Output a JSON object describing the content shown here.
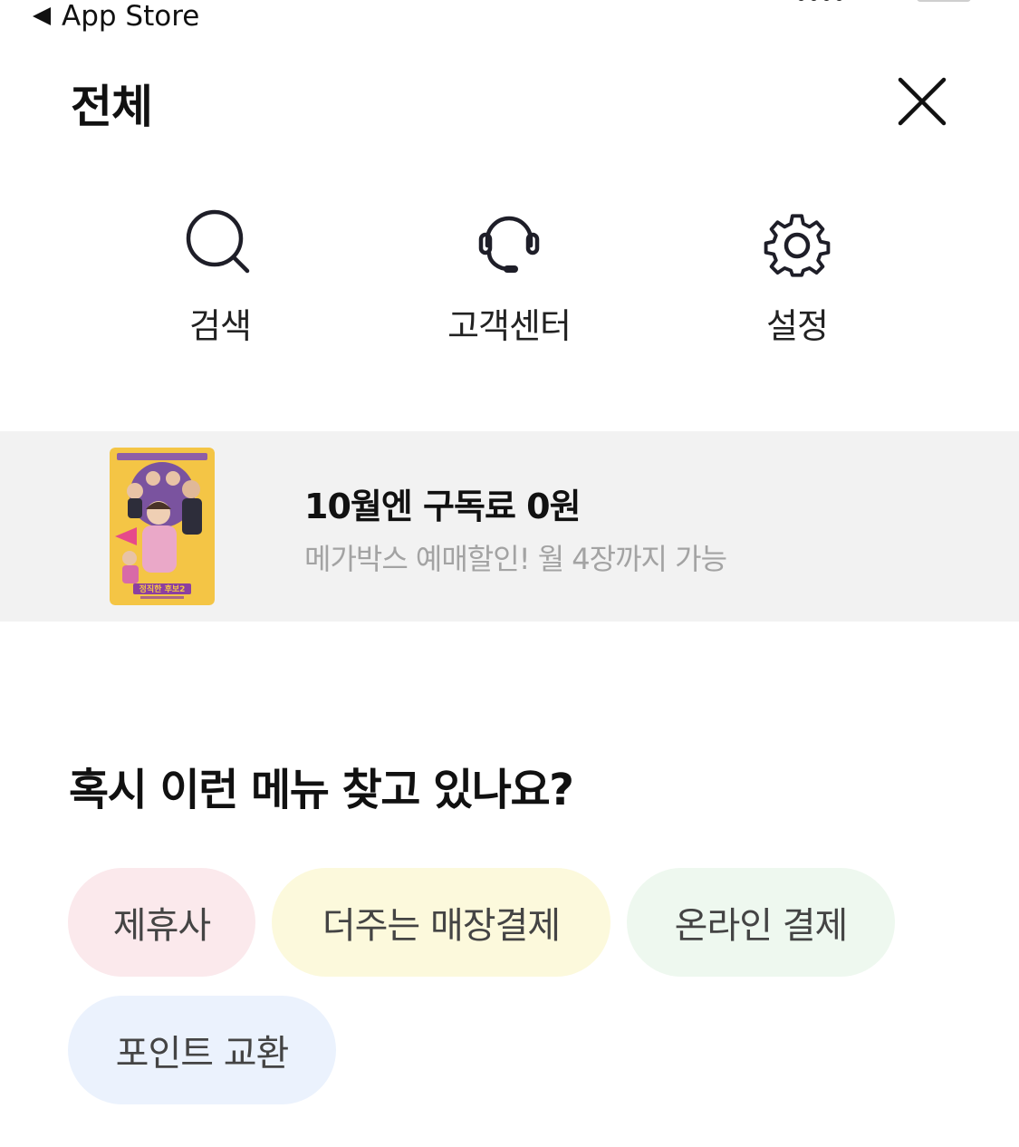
{
  "status_bar": {
    "back_label": "App Store"
  },
  "header": {
    "title": "전체"
  },
  "quick_menu": [
    {
      "label": "검색",
      "icon": "search-icon"
    },
    {
      "label": "고객센터",
      "icon": "headset-icon"
    },
    {
      "label": "설정",
      "icon": "gear-icon"
    }
  ],
  "banner": {
    "title": "10월엔 구독료 0원",
    "subtitle": "메가박스 예매할인! 월 4장까지 가능",
    "poster_text": "정직한 후보2"
  },
  "suggestions": {
    "title": "혹시 이런 메뉴 찾고 있나요?",
    "chips": [
      {
        "label": "제휴사",
        "bg": "#fbe9ec"
      },
      {
        "label": "더주는 매장결제",
        "bg": "#fcf9dc"
      },
      {
        "label": "온라인 결제",
        "bg": "#eef8ef"
      },
      {
        "label": "포인트 교환",
        "bg": "#ebf2fd"
      }
    ]
  },
  "colors": {
    "banner_bg": "#f2f2f2",
    "subtitle_gray": "#a3a3a3",
    "poster_yellow": "#f4c545"
  }
}
